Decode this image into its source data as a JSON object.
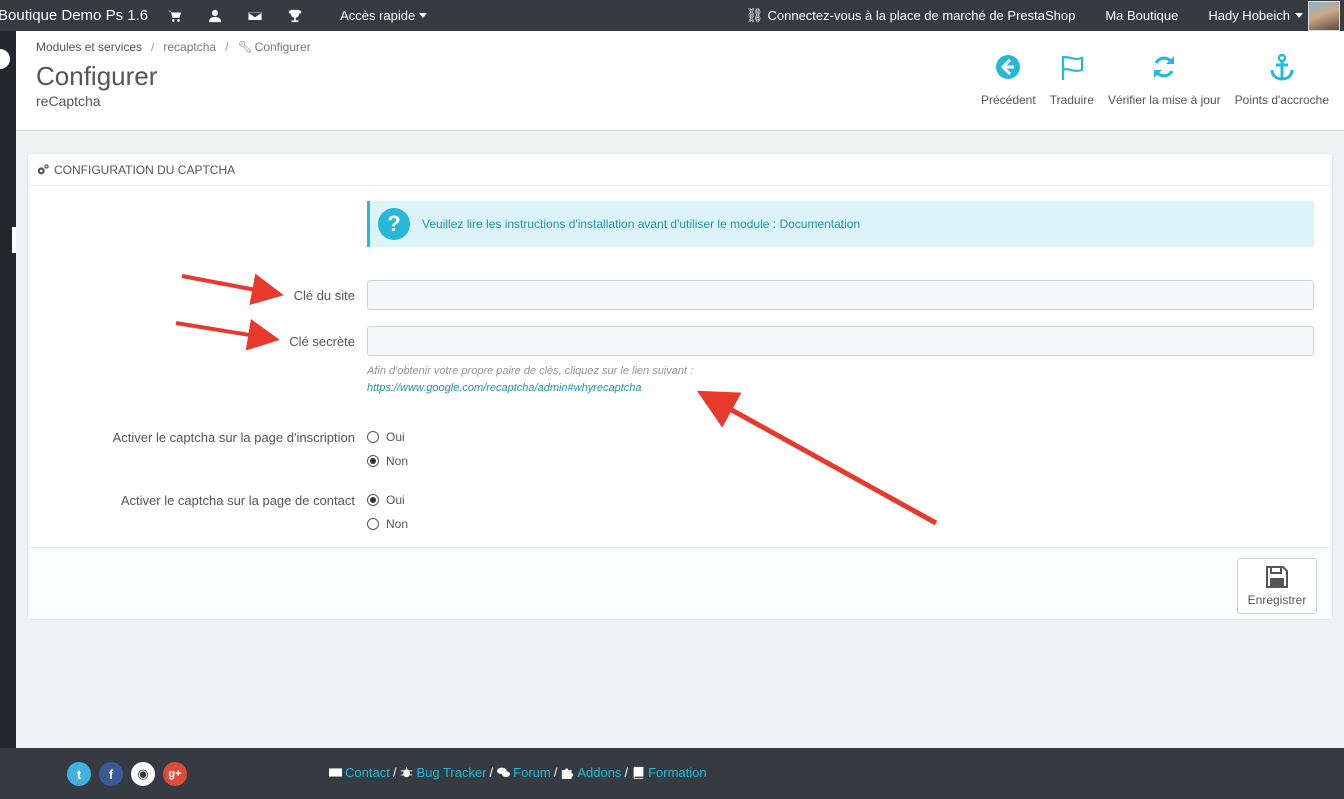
{
  "topbar": {
    "brand": "Boutique Demo Ps 1.6",
    "icons": [
      "cart-icon",
      "user-icon",
      "envelope-icon",
      "trophy-icon"
    ],
    "quick_access": "Accès rapide",
    "connect": "Connectez-vous à la place de marché de PrestaShop",
    "shop": "Ma Boutique",
    "user": "Hady Hobeich"
  },
  "breadcrumb": {
    "item1": "Modules et services",
    "item2": "recaptcha",
    "item3": "Configurer"
  },
  "page": {
    "title": "Configurer",
    "subtitle": "reCaptcha"
  },
  "toolbar": {
    "back": "Précédent",
    "translate": "Traduire",
    "check_update": "Vérifier la mise à jour",
    "hooks": "Points d'accroche"
  },
  "panel": {
    "heading": "Configuration du captcha",
    "alert_text": "Veuillez lire les instructions d'installation avant d'utiliser le module : ",
    "alert_link": "Documentation",
    "site_key_label": "Clé du site",
    "site_key_value": "",
    "secret_key_label": "Clé secrète",
    "secret_key_value": "",
    "help_text": "Afin d'obtenir votre propre paire de clés, cliquez sur le lien suivant :",
    "help_link": "https://www.google.com/recaptcha/admin#whyrecaptcha",
    "signup_label": "Activer le captcha sur la page d'inscription",
    "signup_yes": "Oui",
    "signup_no": "Non",
    "signup_selected": "Non",
    "contact_label": "Activer le captcha sur la page de contact",
    "contact_yes": "Oui",
    "contact_no": "Non",
    "contact_selected": "Oui",
    "save": "Enregistrer"
  },
  "footer": {
    "socials": [
      "twitter-icon",
      "facebook-icon",
      "github-icon",
      "google-plus-icon"
    ],
    "links": {
      "contact": "Contact",
      "bug_tracker": "Bug Tracker",
      "forum": "Forum",
      "addons": "Addons",
      "formation": "Formation"
    }
  },
  "colors": {
    "topbar": "#363a41",
    "accent": "#25b9d7",
    "arrow": "#e8392d"
  }
}
